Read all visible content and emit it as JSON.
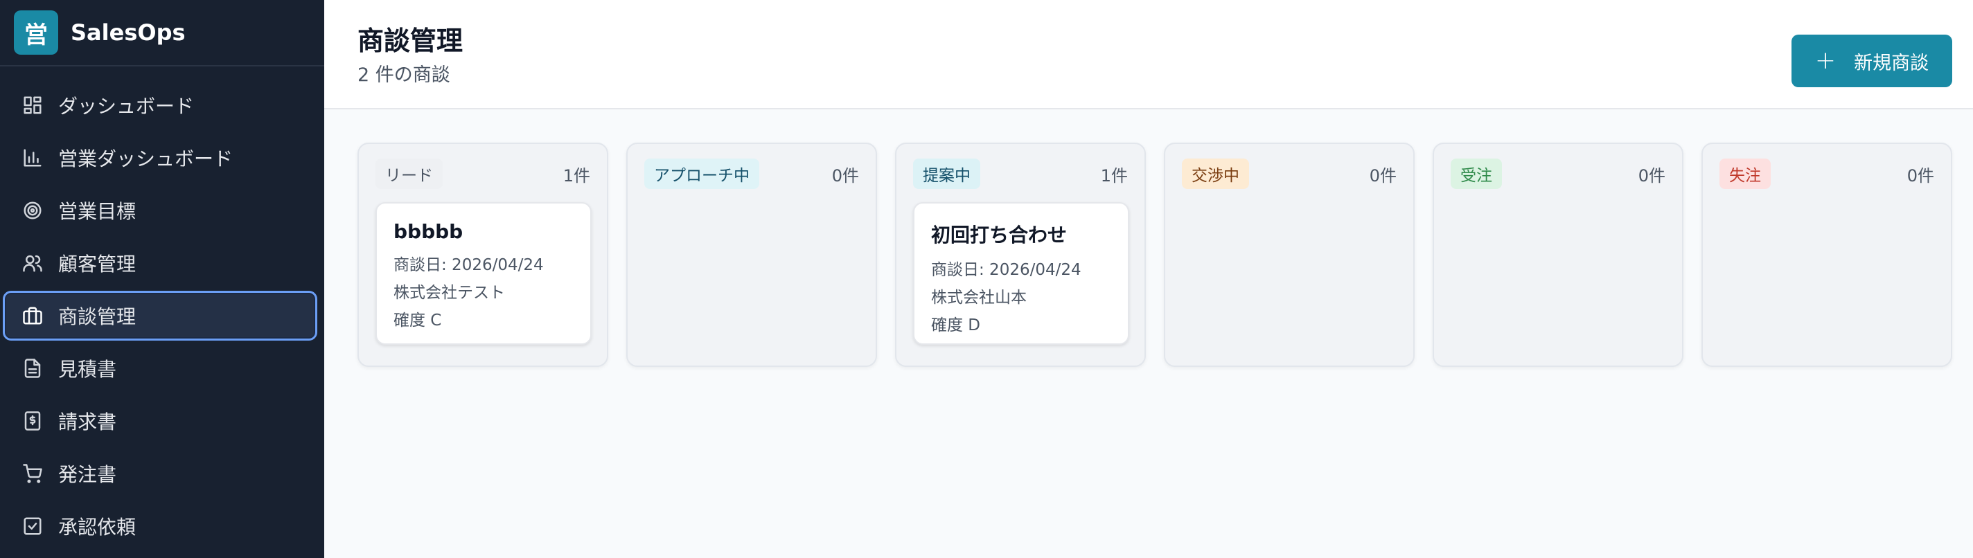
{
  "brand": {
    "logo_char": "営",
    "name": "SalesOps"
  },
  "sidebar": {
    "items": [
      {
        "label": "ダッシュボード",
        "icon": "dashboard-icon",
        "active": false
      },
      {
        "label": "営業ダッシュボード",
        "icon": "bar-chart-icon",
        "active": false
      },
      {
        "label": "営業目標",
        "icon": "target-icon",
        "active": false
      },
      {
        "label": "顧客管理",
        "icon": "users-icon",
        "active": false
      },
      {
        "label": "商談管理",
        "icon": "briefcase-icon",
        "active": true
      },
      {
        "label": "見積書",
        "icon": "document-icon",
        "active": false
      },
      {
        "label": "請求書",
        "icon": "receipt-icon",
        "active": false
      },
      {
        "label": "発注書",
        "icon": "cart-icon",
        "active": false
      },
      {
        "label": "承認依頼",
        "icon": "check-square-icon",
        "active": false
      }
    ]
  },
  "header": {
    "title": "商談管理",
    "subtitle": "2 件の商談",
    "new_button": {
      "plus": "+",
      "label": "新規商談"
    }
  },
  "board": {
    "columns": [
      {
        "label": "リード",
        "count": "1件",
        "badge_bg": "#eef0f3",
        "badge_fg": "#4b5563",
        "card": {
          "title": "bbbbb",
          "date": "商談日: 2026/04/24",
          "company": "株式会社テスト",
          "certainty": "確度 C"
        }
      },
      {
        "label": "アプローチ中",
        "count": "0件",
        "badge_bg": "#dff3f7",
        "badge_fg": "#14506a"
      },
      {
        "label": "提案中",
        "count": "1件",
        "badge_bg": "#dcf2f6",
        "badge_fg": "#14506a",
        "card": {
          "title": "初回打ち合わせ",
          "date": "商談日: 2026/04/24",
          "company": "株式会社山本",
          "certainty": "確度 D"
        }
      },
      {
        "label": "交渉中",
        "count": "0件",
        "badge_bg": "#fdebd3",
        "badge_fg": "#7a3d10"
      },
      {
        "label": "受注",
        "count": "0件",
        "badge_bg": "#dcf3e3",
        "badge_fg": "#2f8a4a"
      },
      {
        "label": "失注",
        "count": "0件",
        "badge_bg": "#fde0e0",
        "badge_fg": "#c0392b"
      }
    ]
  }
}
